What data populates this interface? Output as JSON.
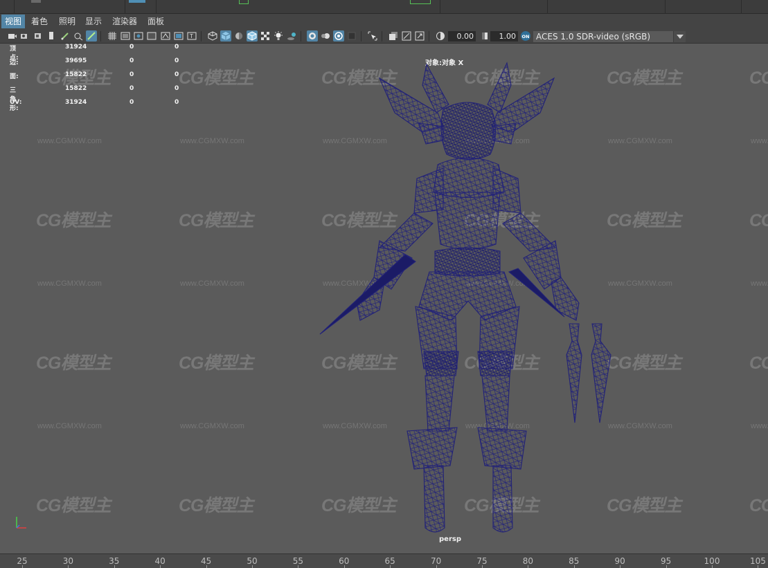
{
  "menu": {
    "items": [
      {
        "label": "视图",
        "active": true
      },
      {
        "label": "着色",
        "active": false
      },
      {
        "label": "照明",
        "active": false
      },
      {
        "label": "显示",
        "active": false
      },
      {
        "label": "渲染器",
        "active": false
      },
      {
        "label": "面板",
        "active": false
      }
    ]
  },
  "toolbar": {
    "exposure_value": "0.00",
    "gamma_value": "1.00",
    "color_space": "ACES 1.0 SDR-video (sRGB)",
    "accent": "#5285a6"
  },
  "hud": {
    "rows": [
      {
        "label": "顶点:",
        "total": "31924",
        "selected": "0",
        "triangles": "0"
      },
      {
        "label": "边:",
        "total": "39695",
        "selected": "0",
        "triangles": "0"
      },
      {
        "label": "面:",
        "total": "15822",
        "selected": "0",
        "triangles": "0"
      },
      {
        "label": "三角形:",
        "total": "15822",
        "selected": "0",
        "triangles": "0"
      },
      {
        "label": "UV:",
        "total": "31924",
        "selected": "0",
        "triangles": "0"
      }
    ],
    "object_label": "对象:对象 X",
    "camera_label": "persp"
  },
  "watermark": {
    "logo_text": "CG模型主",
    "url_text": "www.CGMXW.com"
  },
  "timeline": {
    "ticks": [
      "25",
      "30",
      "35",
      "40",
      "45",
      "50",
      "55",
      "60",
      "65",
      "70",
      "75",
      "80",
      "85",
      "90",
      "95",
      "100",
      "105"
    ]
  },
  "colors": {
    "viewport_bg": "#5b5b5b",
    "wireframe": "#2a2a8a",
    "menu_active": "#5285a6"
  }
}
